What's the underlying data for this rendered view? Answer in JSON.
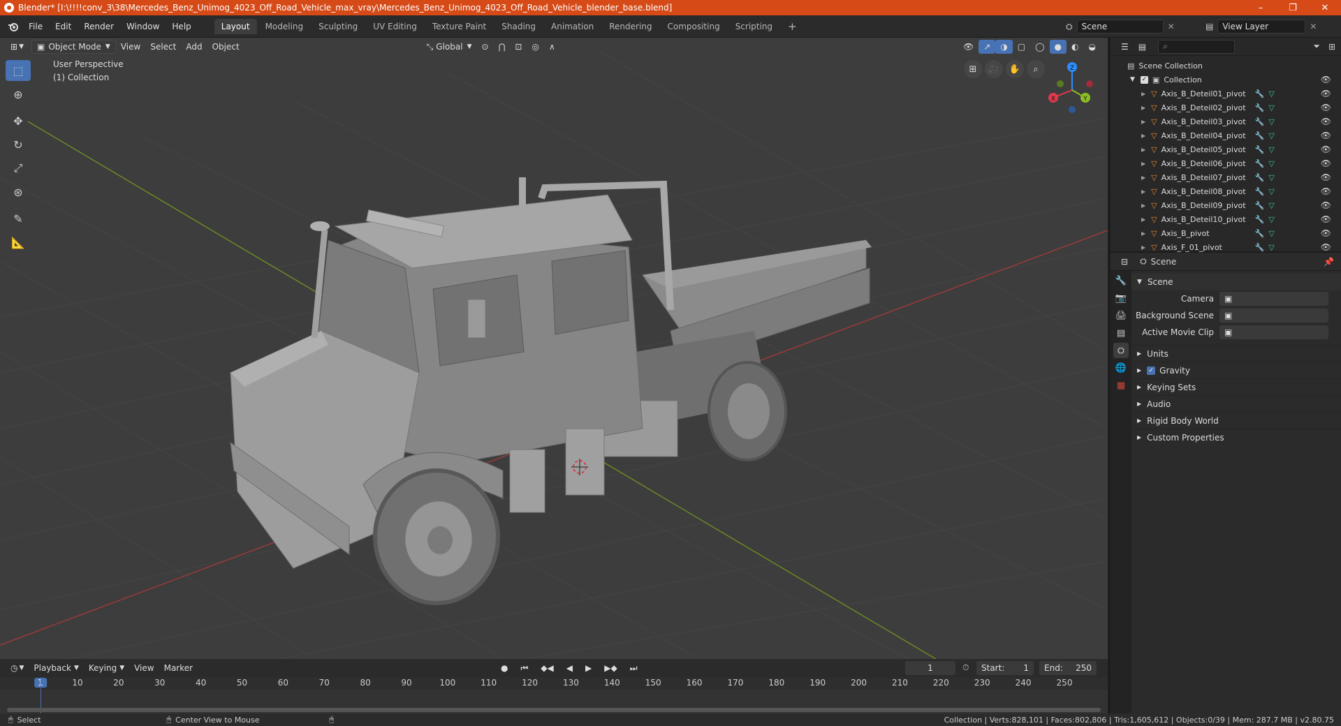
{
  "window": {
    "title": "Blender* [I:\\!!!!conv_3\\38\\Mercedes_Benz_Unimog_4023_Off_Road_Vehicle_max_vray\\Mercedes_Benz_Unimog_4023_Off_Road_Vehicle_blender_base.blend]",
    "minimize": "–",
    "maximize": "❐",
    "close": "✕"
  },
  "menu": [
    "File",
    "Edit",
    "Render",
    "Window",
    "Help"
  ],
  "workspaces": [
    "Layout",
    "Modeling",
    "Sculpting",
    "UV Editing",
    "Texture Paint",
    "Shading",
    "Animation",
    "Rendering",
    "Compositing",
    "Scripting"
  ],
  "add_workspace": "+",
  "scene_field": "Scene",
  "view_layer_field": "View Layer",
  "viewport_header": {
    "mode": "Object Mode",
    "menus": [
      "View",
      "Select",
      "Add",
      "Object"
    ],
    "transform": "Global"
  },
  "viewport_overlay": {
    "perspective": "User Perspective",
    "collection": "(1) Collection"
  },
  "gizmo": {
    "x": "X",
    "y": "Y",
    "z": "Z"
  },
  "outliner": {
    "root": "Scene Collection",
    "collection": "Collection",
    "items": [
      "Axis_B_Deteil01_pivot",
      "Axis_B_Deteil02_pivot",
      "Axis_B_Deteil03_pivot",
      "Axis_B_Deteil04_pivot",
      "Axis_B_Deteil05_pivot",
      "Axis_B_Deteil06_pivot",
      "Axis_B_Deteil07_pivot",
      "Axis_B_Deteil08_pivot",
      "Axis_B_Deteil09_pivot",
      "Axis_B_Deteil10_pivot",
      "Axis_B_pivot",
      "Axis_F_01_pivot"
    ]
  },
  "properties": {
    "header": "Scene",
    "panel": "Scene",
    "fields": [
      {
        "label": "Camera",
        "value": ""
      },
      {
        "label": "Background Scene",
        "value": ""
      },
      {
        "label": "Active Movie Clip",
        "value": ""
      }
    ],
    "sections": [
      "Units",
      "Gravity",
      "Keying Sets",
      "Audio",
      "Rigid Body World",
      "Custom Properties"
    ]
  },
  "timeline": {
    "menus": [
      "Playback",
      "Keying",
      "View",
      "Marker"
    ],
    "current_frame": "1",
    "start_label": "Start:",
    "start": "1",
    "end_label": "End:",
    "end": "250",
    "ticks": [
      "1",
      "10",
      "20",
      "30",
      "40",
      "50",
      "60",
      "70",
      "80",
      "90",
      "100",
      "110",
      "120",
      "130",
      "140",
      "150",
      "160",
      "170",
      "180",
      "190",
      "200",
      "210",
      "220",
      "230",
      "240",
      "250"
    ]
  },
  "statusbar": {
    "select": "Select",
    "center": "Center View to Mouse",
    "stats": "Collection | Verts:828,101 | Faces:802,806 | Tris:1,605,612 | Objects:0/39 | Mem: 287.7 MB | v2.80.75"
  },
  "colors": {
    "title_bar": "#d64a17",
    "active_tool": "#4772b3",
    "axis_x": "#e0394d",
    "axis_y": "#8cbf26",
    "axis_z": "#2c8fff"
  }
}
